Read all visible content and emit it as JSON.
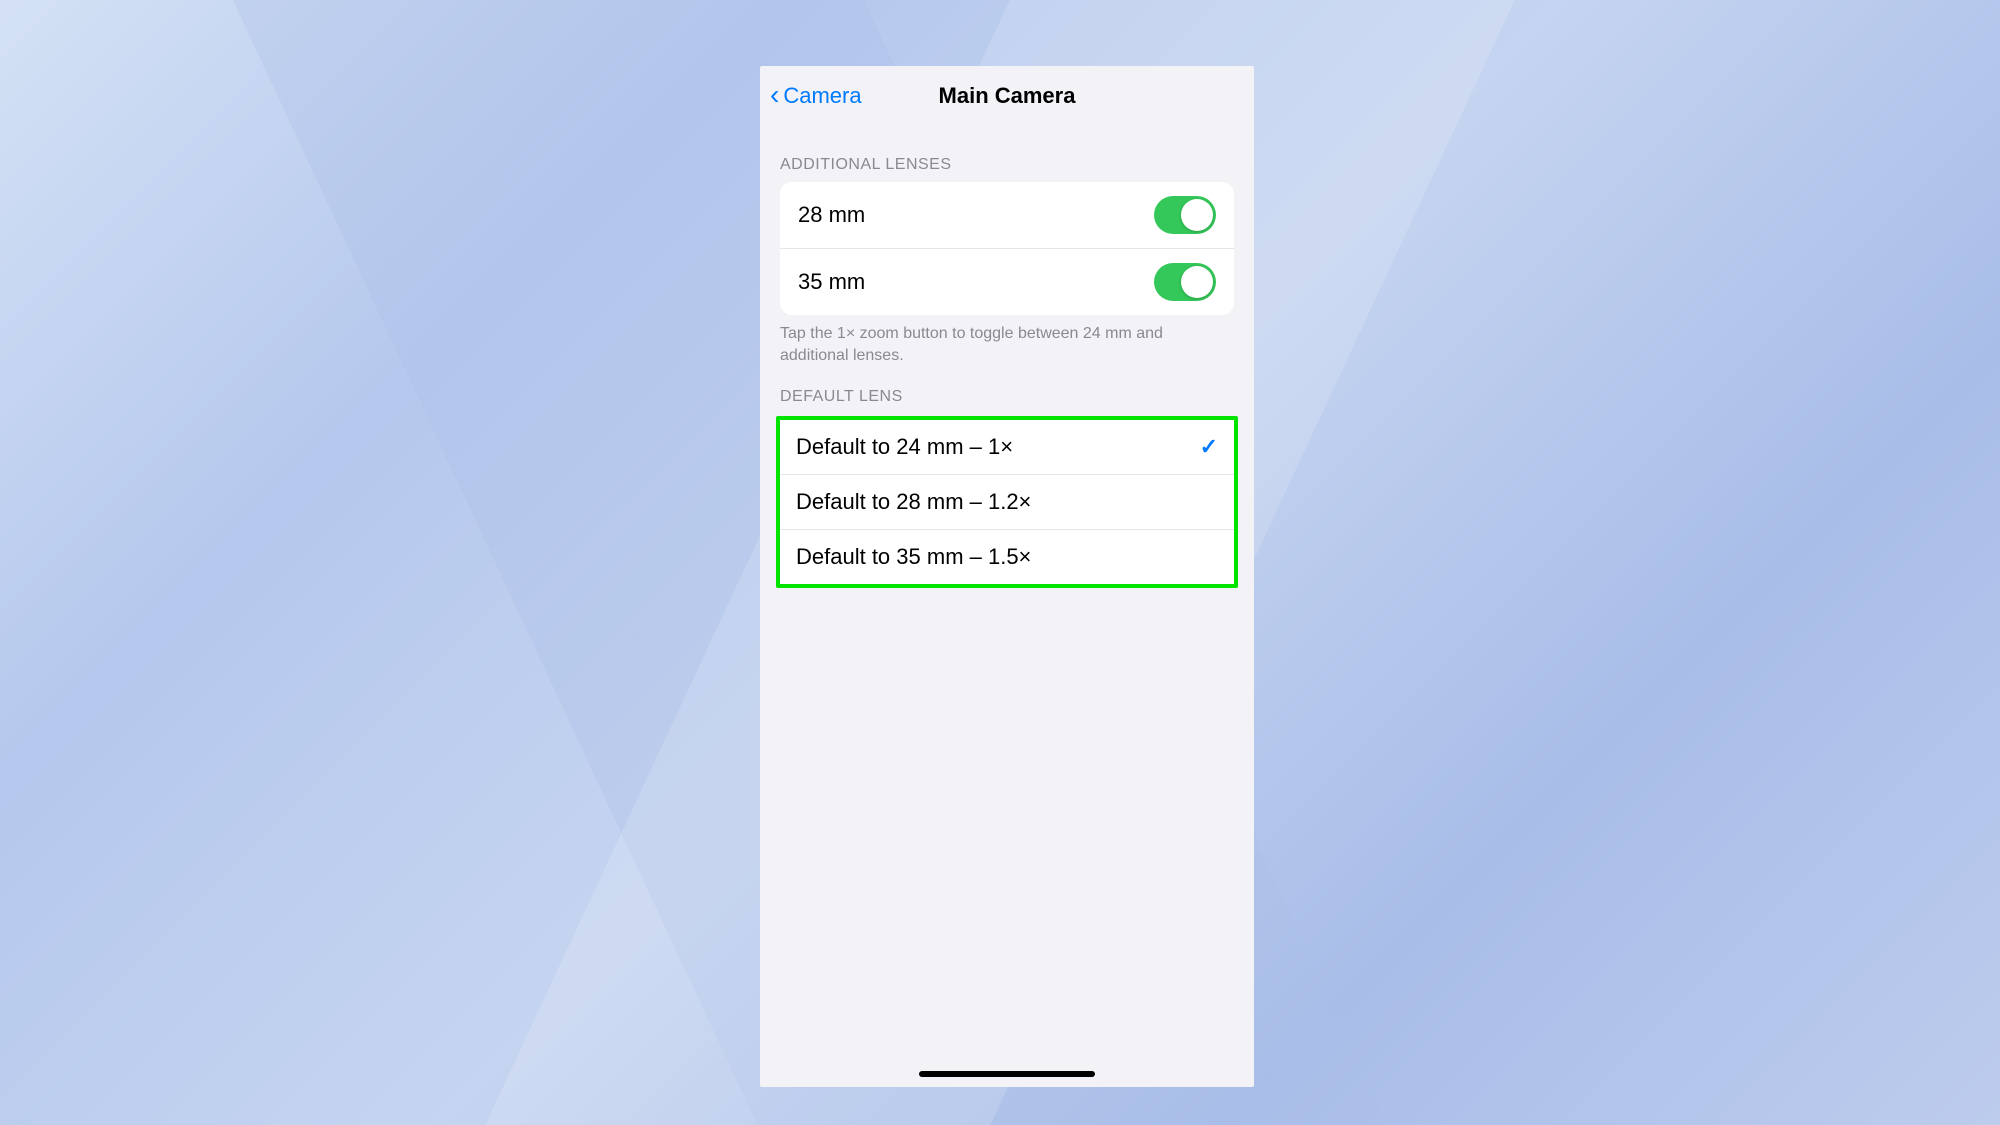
{
  "nav": {
    "back_label": "Camera",
    "title": "Main Camera"
  },
  "section_lenses": {
    "header": "Additional Lenses",
    "rows": [
      {
        "label": "28 mm",
        "enabled": true
      },
      {
        "label": "35 mm",
        "enabled": true
      }
    ],
    "footer": "Tap the 1× zoom button to toggle between 24 mm and additional lenses."
  },
  "section_default": {
    "header": "Default Lens",
    "rows": [
      {
        "label": "Default to 24 mm – 1×",
        "selected": true
      },
      {
        "label": "Default to 28 mm – 1.2×",
        "selected": false
      },
      {
        "label": "Default to 35 mm – 1.5×",
        "selected": false
      }
    ]
  }
}
